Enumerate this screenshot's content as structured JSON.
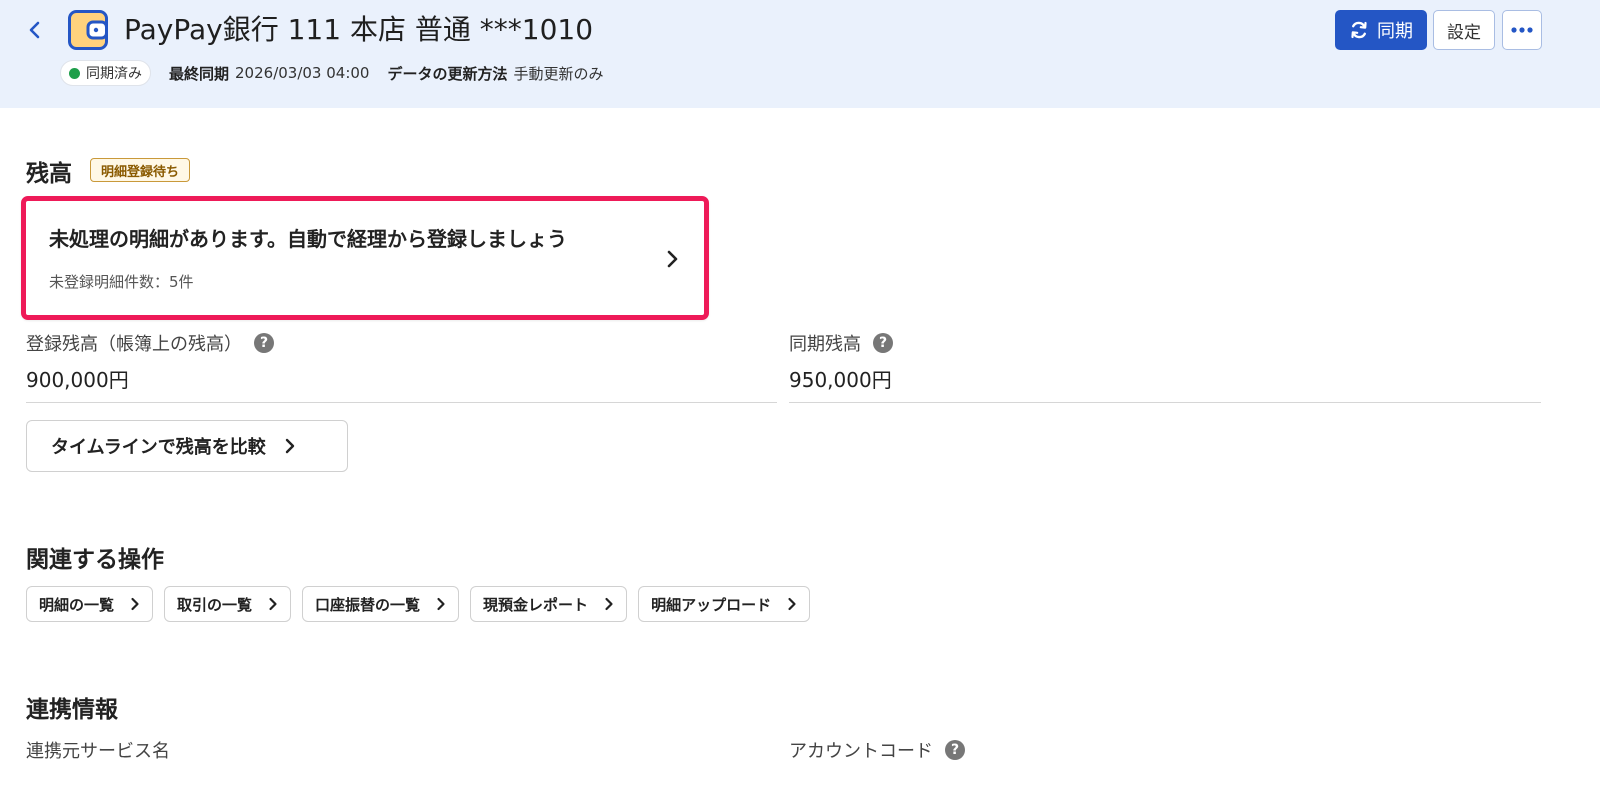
{
  "header": {
    "title": "PayPay銀行 111 本店 普通 ***1010",
    "sync_status": "同期済み",
    "last_sync_label": "最終同期",
    "last_sync_value": "2026/03/03 04:00",
    "update_method_label": "データの更新方法",
    "update_method_value": "手動更新のみ",
    "sync_button": "同期",
    "settings_button": "設定",
    "colors": {
      "background": "#eaf1fc",
      "primary": "#2456c5",
      "status_ok": "#1e9e4a"
    }
  },
  "balance": {
    "title": "残高",
    "badge": "明細登録待ち",
    "alert": {
      "title": "未処理の明細があります。自動で経理から登録しましょう",
      "subtitle": "未登録明細件数：5件",
      "border_color": "#ee1a58"
    },
    "registered_label": "登録残高（帳簿上の残高）",
    "registered_value": "900,000円",
    "synced_label": "同期残高",
    "synced_value": "950,000円",
    "timeline_button": "タイムラインで残高を比較"
  },
  "related_ops": {
    "title": "関連する操作",
    "items": [
      "明細の一覧",
      "取引の一覧",
      "口座振替の一覧",
      "現預金レポート",
      "明細アップロード"
    ]
  },
  "link_info": {
    "title": "連携情報",
    "service_label": "連携元サービス名",
    "account_code_label": "アカウントコード"
  }
}
